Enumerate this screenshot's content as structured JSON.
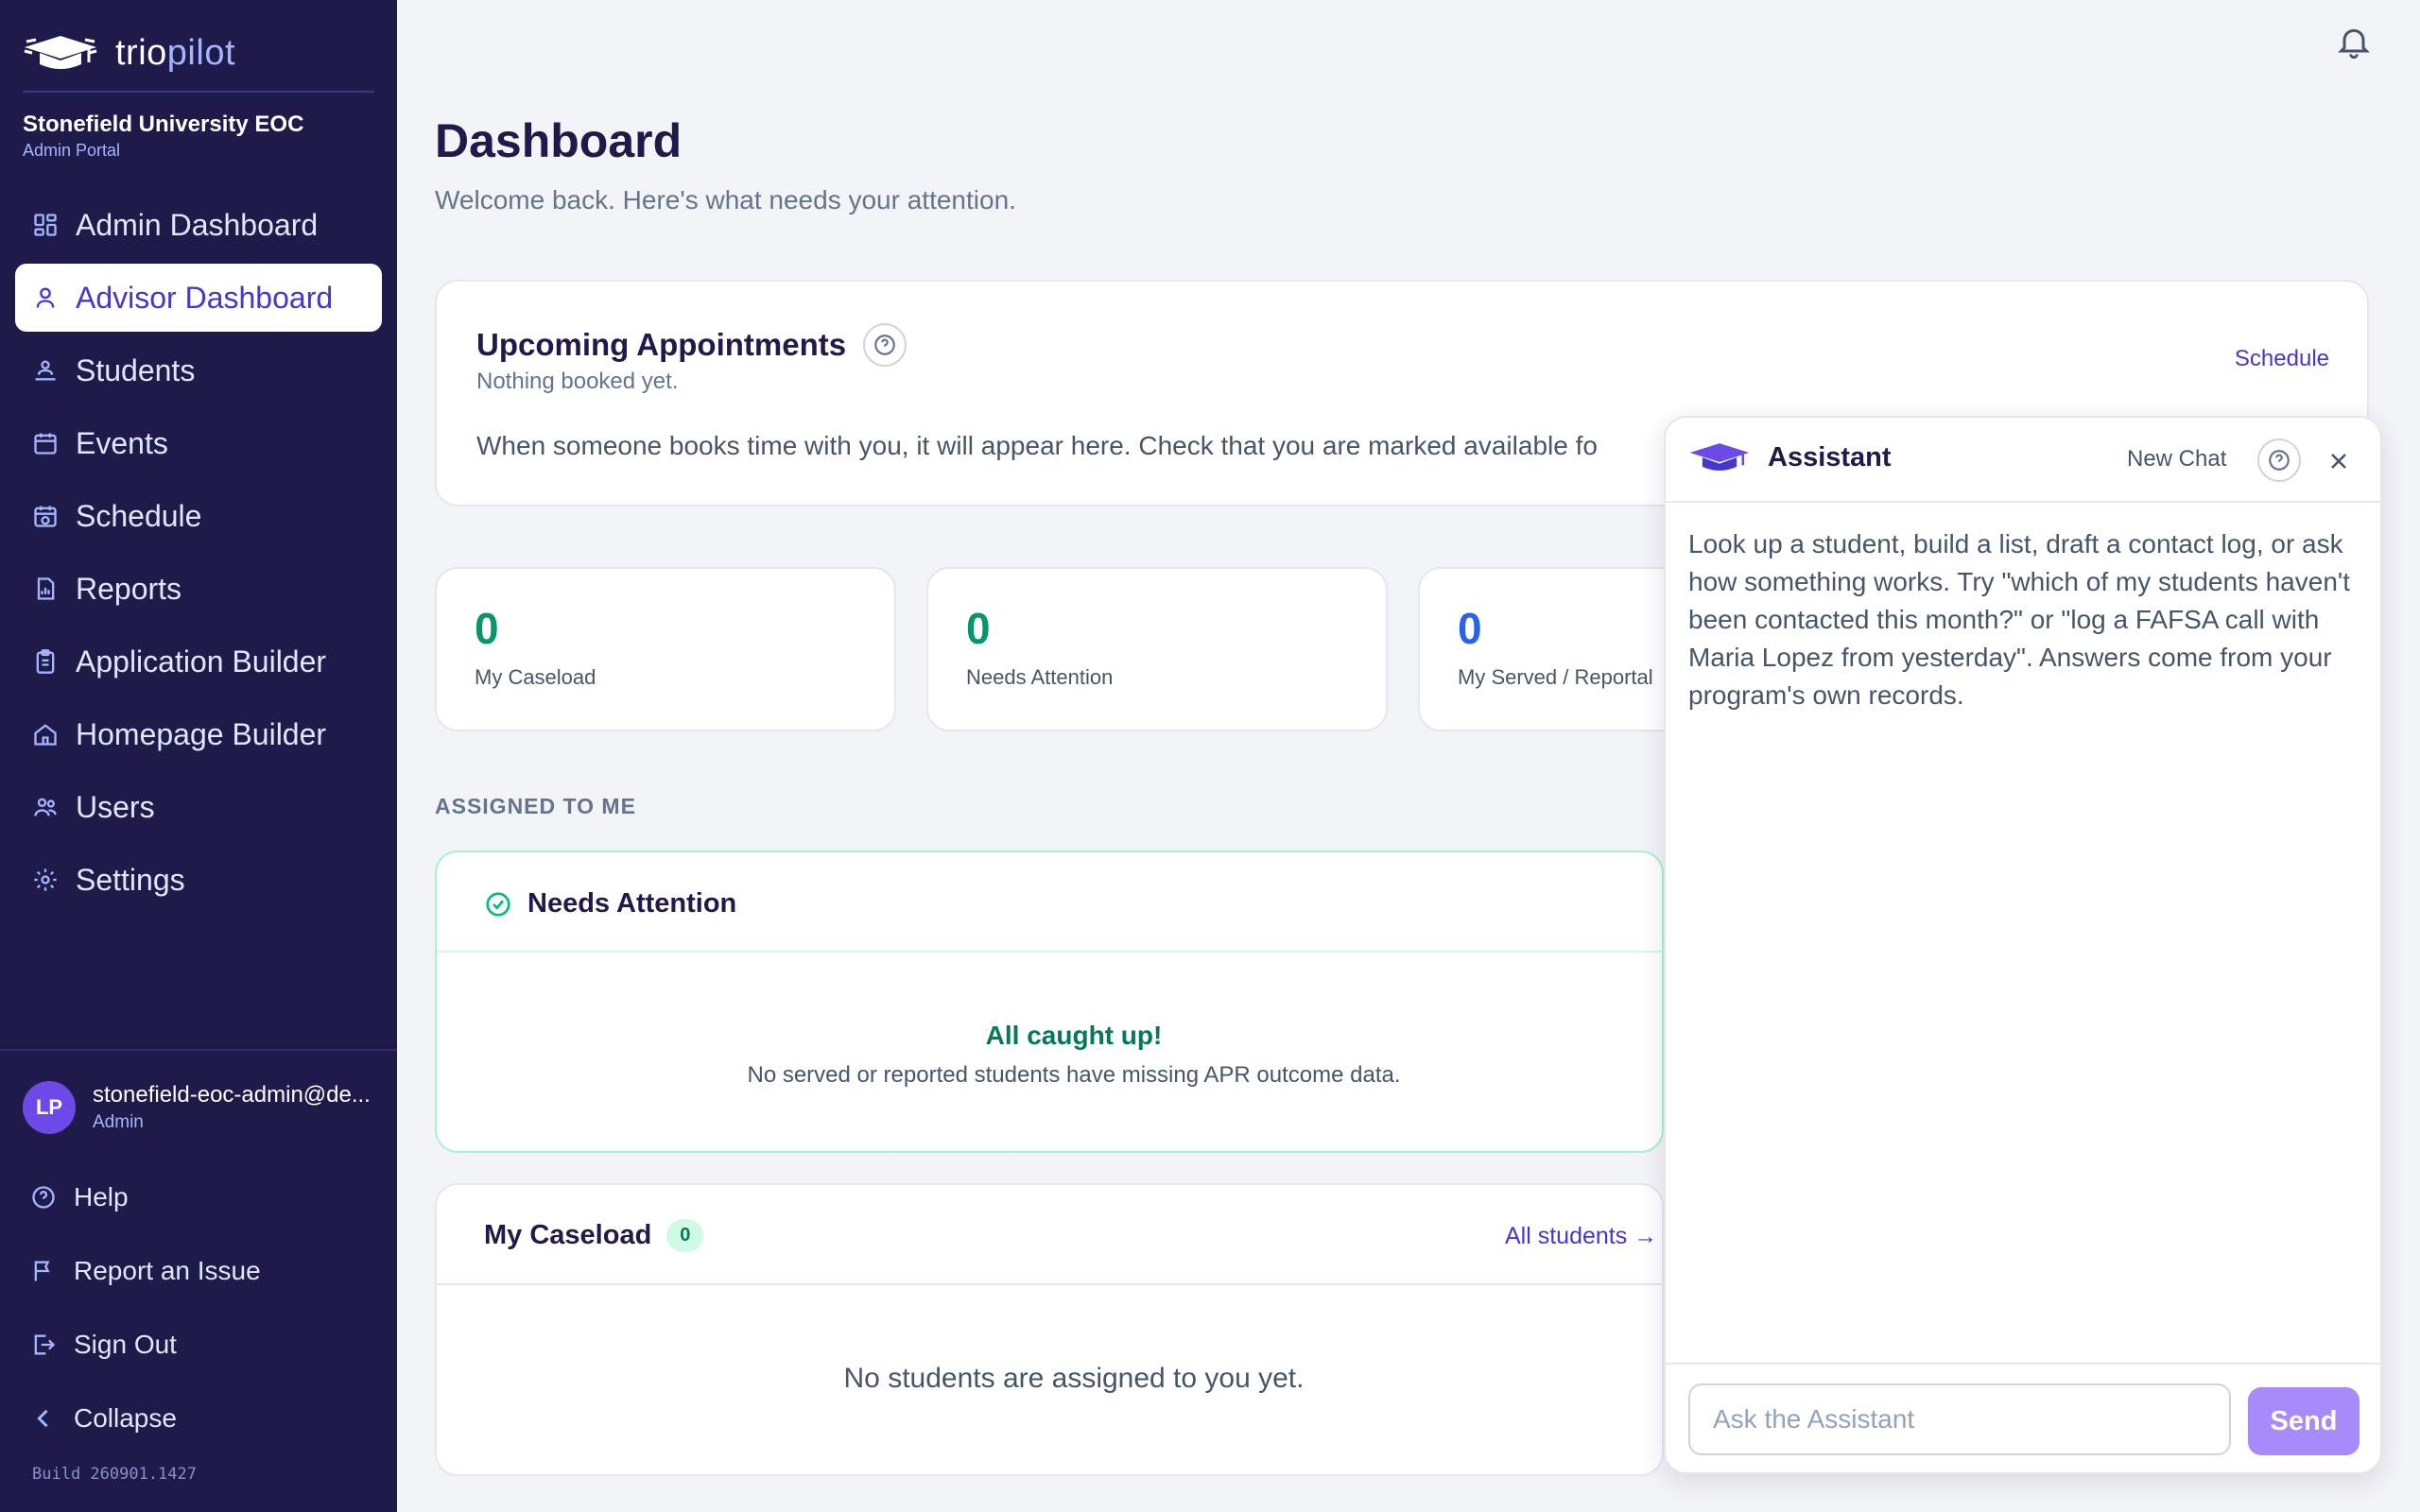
{
  "brand": {
    "name_bold": "trio",
    "name_light": "pilot"
  },
  "org": {
    "name": "Stonefield University EOC",
    "portal": "Admin Portal"
  },
  "nav": [
    {
      "label": "Admin Dashboard",
      "icon": "grid-icon"
    },
    {
      "label": "Advisor Dashboard",
      "icon": "user-icon",
      "active": true
    },
    {
      "label": "Students",
      "icon": "students-icon"
    },
    {
      "label": "Events",
      "icon": "calendar-icon"
    },
    {
      "label": "Schedule",
      "icon": "calendar-clock-icon"
    },
    {
      "label": "Reports",
      "icon": "report-icon"
    },
    {
      "label": "Application Builder",
      "icon": "clipboard-icon"
    },
    {
      "label": "Homepage Builder",
      "icon": "home-icon"
    },
    {
      "label": "Users",
      "icon": "users-icon"
    },
    {
      "label": "Settings",
      "icon": "gear-icon"
    }
  ],
  "user": {
    "initials": "LP",
    "email": "stonefield-eoc-admin@de...",
    "role": "Admin"
  },
  "bottom_nav": {
    "help": "Help",
    "report": "Report an Issue",
    "signout": "Sign Out",
    "collapse": "Collapse"
  },
  "build": "Build 260901.1427",
  "page": {
    "title": "Dashboard",
    "subtitle": "Welcome back. Here's what needs your attention."
  },
  "appointments": {
    "title": "Upcoming Appointments",
    "subtitle": "Nothing booked yet.",
    "body": "When someone books time with you, it will appear here. Check that you are marked available fo",
    "link": "Schedule"
  },
  "stats": [
    {
      "value": "0",
      "label": "My Caseload",
      "color": "#059669"
    },
    {
      "value": "0",
      "label": "Needs Attention",
      "color": "#059669"
    },
    {
      "value": "0",
      "label": "My Served / Reportal",
      "color": "#2563eb"
    }
  ],
  "assigned": {
    "label": "ASSIGNED TO ME",
    "attention_title": "Needs Attention",
    "caught_up": "All caught up!",
    "caught_up_note": "No served or reported students have missing APR outcome data."
  },
  "caseload": {
    "title": "My Caseload",
    "count": "0",
    "link": "All students →",
    "empty": "No students are assigned to you yet."
  },
  "assistant": {
    "title": "Assistant",
    "new_chat": "New Chat",
    "message": "Look up a student, build a list, draft a contact log, or ask how something works. Try \"which of my students haven't been contacted this month?\" or \"log a FAFSA call with Maria Lopez from yesterday\". Answers come from your program's own records.",
    "input_placeholder": "Ask the Assistant",
    "send": "Send"
  },
  "colors": {
    "sidebar": "#1e1b4b",
    "accent": "#4338ca",
    "success": "#059669",
    "send_button": "#a78bfa"
  }
}
